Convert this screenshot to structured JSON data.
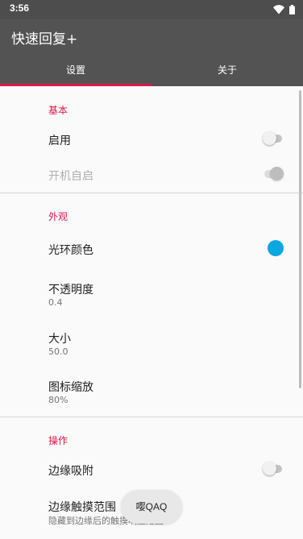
{
  "status_bar": {
    "time": "3:56",
    "icons": [
      "wifi-icon",
      "battery-icon"
    ]
  },
  "app": {
    "title": "快速回复+"
  },
  "tabs": [
    {
      "label": "设置",
      "active": true
    },
    {
      "label": "关于",
      "active": false
    }
  ],
  "sections": {
    "basic": {
      "header": "基本",
      "enable": {
        "title": "启用",
        "on": false
      },
      "boot_start": {
        "title": "开机自启",
        "on": true,
        "enabled": false
      }
    },
    "appearance": {
      "header": "外观",
      "halo_color": {
        "title": "光环颜色",
        "color": "#0aa7e0"
      },
      "opacity": {
        "title": "不透明度",
        "value": "0.4"
      },
      "size": {
        "title": "大小",
        "value": "50.0"
      },
      "icon_scale": {
        "title": "图标缩放",
        "value": "80%"
      }
    },
    "operation": {
      "header": "操作",
      "edge_snap": {
        "title": "边缘吸附",
        "on": false
      },
      "edge_touch_range": {
        "title": "边缘触摸范围",
        "summary": "隐藏到边缘后的触摸响应范围"
      }
    }
  },
  "toast": {
    "text": "嘤QAQ"
  },
  "colors": {
    "app_bar": "#535353",
    "status_bar": "#4d4d4d",
    "accent": "#e0174a",
    "halo": "#0aa7e0"
  }
}
